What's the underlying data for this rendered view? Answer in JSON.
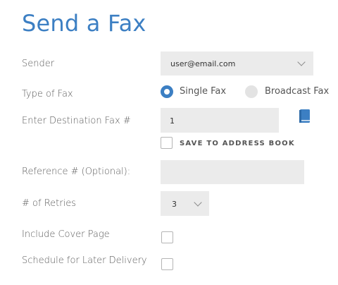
{
  "page": {
    "title": "Send a Fax"
  },
  "sender": {
    "label": "Sender",
    "value": "user@email.com"
  },
  "fax_type": {
    "label": "Type of Fax",
    "options": [
      {
        "label": "Single Fax",
        "selected": true
      },
      {
        "label": "Broadcast Fax",
        "selected": false
      }
    ]
  },
  "destination": {
    "label": "Enter Destination Fax #",
    "value": "1",
    "address_book_icon": "address-book-icon",
    "save_label": "SAVE TO ADDRESS BOOK",
    "save_checked": false
  },
  "reference": {
    "label": "Reference # (Optional):",
    "value": ""
  },
  "retries": {
    "label": "# of Retries",
    "value": "3"
  },
  "cover_page": {
    "label": "Include Cover Page",
    "checked": false
  },
  "schedule": {
    "label": "Schedule for Later Delivery",
    "checked": false
  },
  "colors": {
    "accent": "#3c7fc3",
    "field_bg": "#ebebeb"
  }
}
